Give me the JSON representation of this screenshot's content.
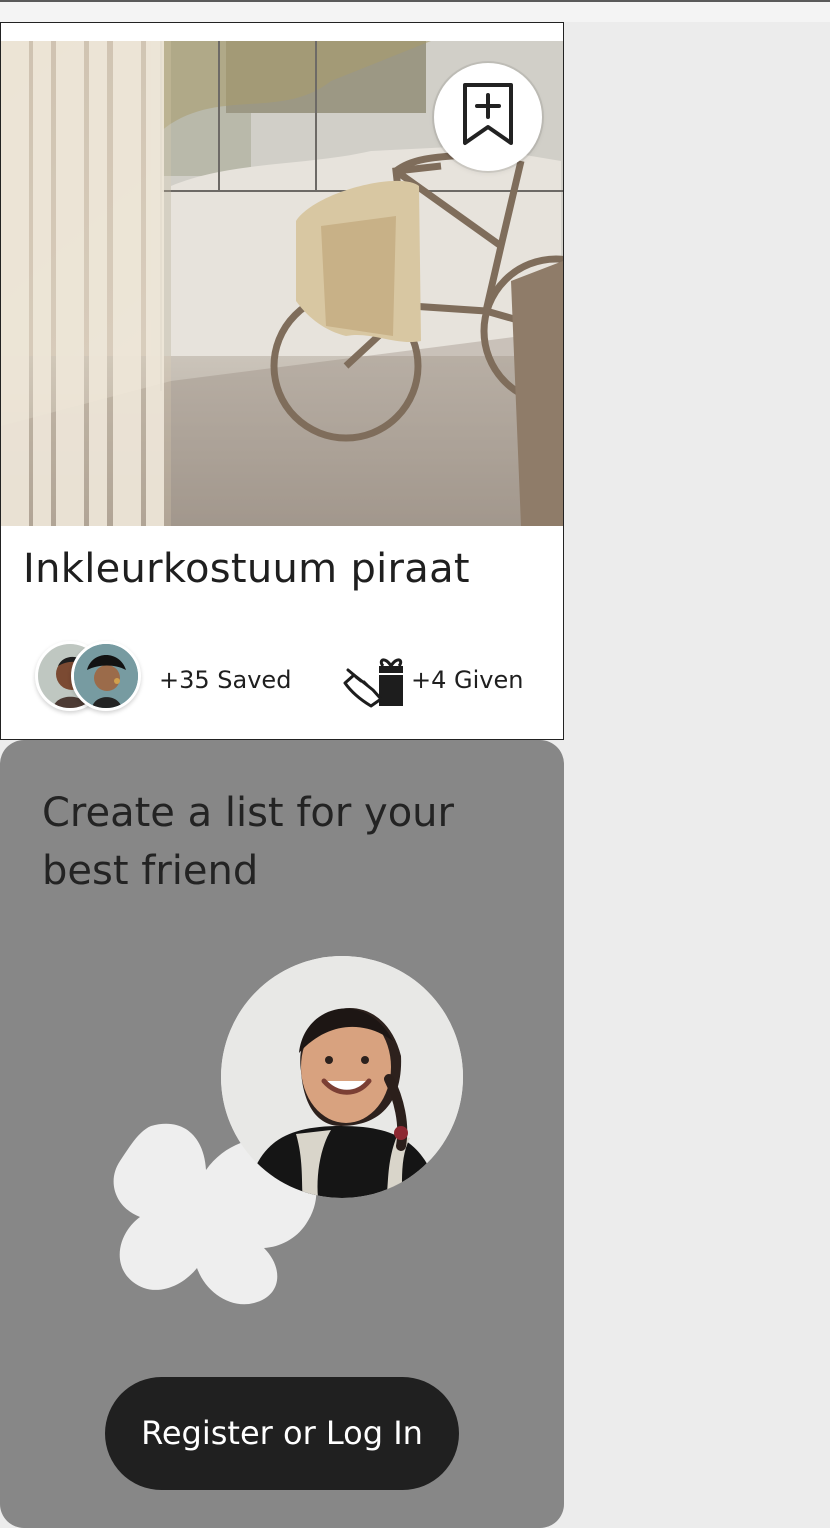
{
  "card": {
    "title": "Inkleurkostuum piraat",
    "saved_text": "+35 Saved",
    "given_text": "+4 Given",
    "bookmark_icon": "bookmark-plus-icon",
    "given_icon": "gift-hand-icon"
  },
  "promo": {
    "title": "Create a list for your best friend",
    "button_label": "Register or Log In"
  },
  "colors": {
    "page_background": "#ececec",
    "card_background": "#ffffff",
    "promo_background": "#878787",
    "flower": "#eeeeee",
    "button_background": "#202020",
    "button_text": "#ffffff"
  }
}
